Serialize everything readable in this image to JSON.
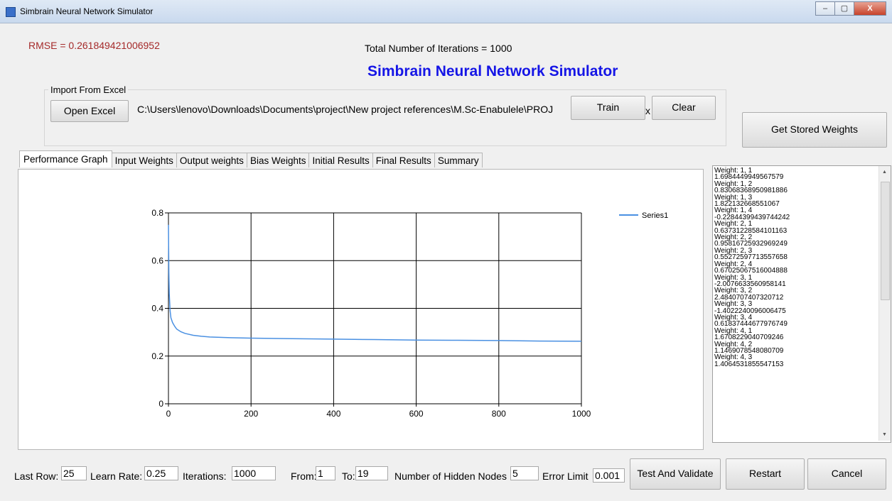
{
  "window": {
    "title": "Simbrain Neural Network Simulator",
    "controls": [
      "–",
      "▢",
      "X"
    ]
  },
  "header": {
    "rmse": "RMSE = 0.261849421006952",
    "total_iterations": "Total Number of Iterations = 1000",
    "app_heading": "Simbrain Neural Network Simulator"
  },
  "import_group": {
    "label": "Import From Excel",
    "open_excel": "Open Excel",
    "file_path": "C:\\Users\\lenovo\\Downloads\\Documents\\project\\New project references\\M.Sc-Enabulele\\PROJ",
    "path_tail": "x",
    "train": "Train",
    "clear": "Clear"
  },
  "get_stored_weights": "Get Stored Weights",
  "tabs": [
    "Performance Graph",
    "Input Weights",
    "Output weights",
    "Bias Weights",
    "Initial Results",
    "Final Results",
    "Summary"
  ],
  "weights_list": [
    "Weight: 1, 1",
    "1.6984449949567579",
    "Weight: 1, 2",
    "0.83068368950981886",
    "Weight: 1, 3",
    "1.822132668551067",
    "Weight: 1, 4",
    "-0.22844399439744242",
    "Weight: 2, 1",
    "0.63731228584101163",
    "Weight: 2, 2",
    "0.95816725932969249",
    "Weight: 2, 3",
    "0.55272597713557658",
    "Weight: 2, 4",
    "0.67025067516004888",
    "Weight: 3, 1",
    "-2.0076633560958141",
    "Weight: 3, 2",
    "2.4840707407320712",
    "Weight: 3, 3",
    "-1.4022240096006475",
    "Weight: 3, 4",
    "0.61837444677976749",
    "Weight: 4, 1",
    "1.6708229040709246",
    "Weight: 4, 2",
    "1.1469078548080709",
    "Weight: 4, 3",
    "1.4064531855547153"
  ],
  "chart_data": {
    "type": "line",
    "title": "",
    "xlabel": "",
    "ylabel": "",
    "xlim": [
      0,
      1000
    ],
    "ylim": [
      0,
      0.8
    ],
    "xticks": [
      "0",
      "200",
      "400",
      "600",
      "800",
      "1000"
    ],
    "yticks": [
      "0",
      "0.2",
      "0.4",
      "0.6",
      "0.8"
    ],
    "grid": true,
    "legend_position": "top-right",
    "series": [
      {
        "name": "Series1",
        "color": "#4a90e2",
        "x": [
          0,
          1,
          2,
          4,
          6,
          10,
          15,
          20,
          30,
          40,
          60,
          80,
          100,
          150,
          200,
          300,
          400,
          500,
          600,
          700,
          800,
          900,
          1000
        ],
        "y": [
          0.75,
          0.55,
          0.46,
          0.39,
          0.36,
          0.34,
          0.325,
          0.313,
          0.302,
          0.295,
          0.287,
          0.283,
          0.28,
          0.277,
          0.275,
          0.273,
          0.271,
          0.269,
          0.267,
          0.266,
          0.265,
          0.263,
          0.262
        ]
      }
    ]
  },
  "bottom": {
    "last_row_label": "Last Row:",
    "last_row": "25",
    "learn_rate_label": "Learn Rate:",
    "learn_rate": "0.25",
    "iterations_label": "Iterations:",
    "iterations": "1000",
    "from_label": "From:",
    "from": "1",
    "to_label": "To:",
    "to": "19",
    "hidden_nodes_label": "Number of Hidden Nodes",
    "hidden_nodes": "5",
    "error_limit_label": "Error Limit",
    "error_limit": "0.001",
    "test_validate": "Test And Validate",
    "restart": "Restart",
    "cancel": "Cancel"
  }
}
